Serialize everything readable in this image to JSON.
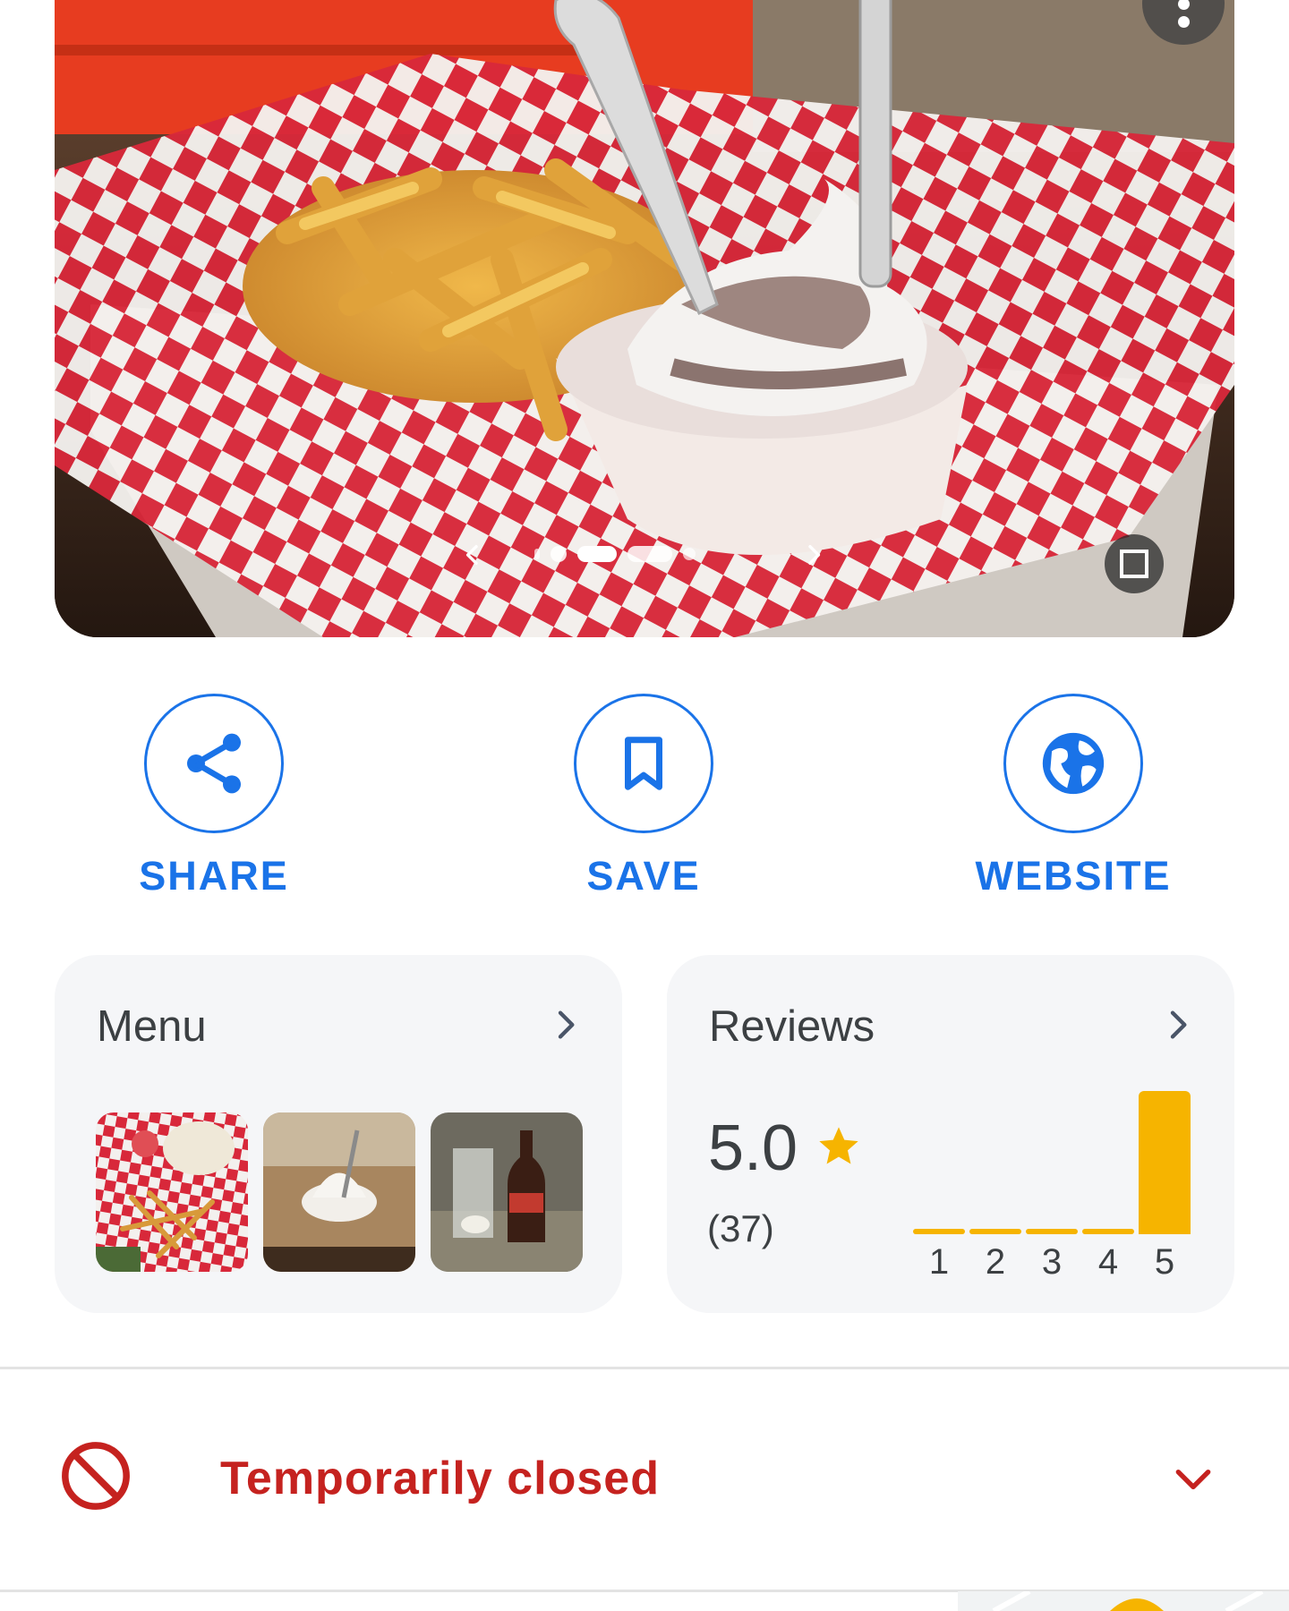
{
  "hero": {
    "photo_description_icon": "food-photo",
    "carousel": {
      "prev_icon": "chevron-left-icon",
      "next_icon": "chevron-right-icon"
    }
  },
  "actions": {
    "share_label": "SHARE",
    "save_label": "SAVE",
    "website_label": "WEBSITE"
  },
  "menu_card": {
    "title": "Menu"
  },
  "reviews_card": {
    "title": "Reviews",
    "rating": "5.0",
    "count": "(37)",
    "distribution": [
      {
        "stars": "1",
        "fraction": 0.02
      },
      {
        "stars": "2",
        "fraction": 0.02
      },
      {
        "stars": "3",
        "fraction": 0.02
      },
      {
        "stars": "4",
        "fraction": 0.03
      },
      {
        "stars": "5",
        "fraction": 1.0
      }
    ]
  },
  "status": {
    "label": "Temporarily closed"
  },
  "colors": {
    "accent": "#1a73e8",
    "star": "#f6b400",
    "closed": "#c5221f"
  }
}
